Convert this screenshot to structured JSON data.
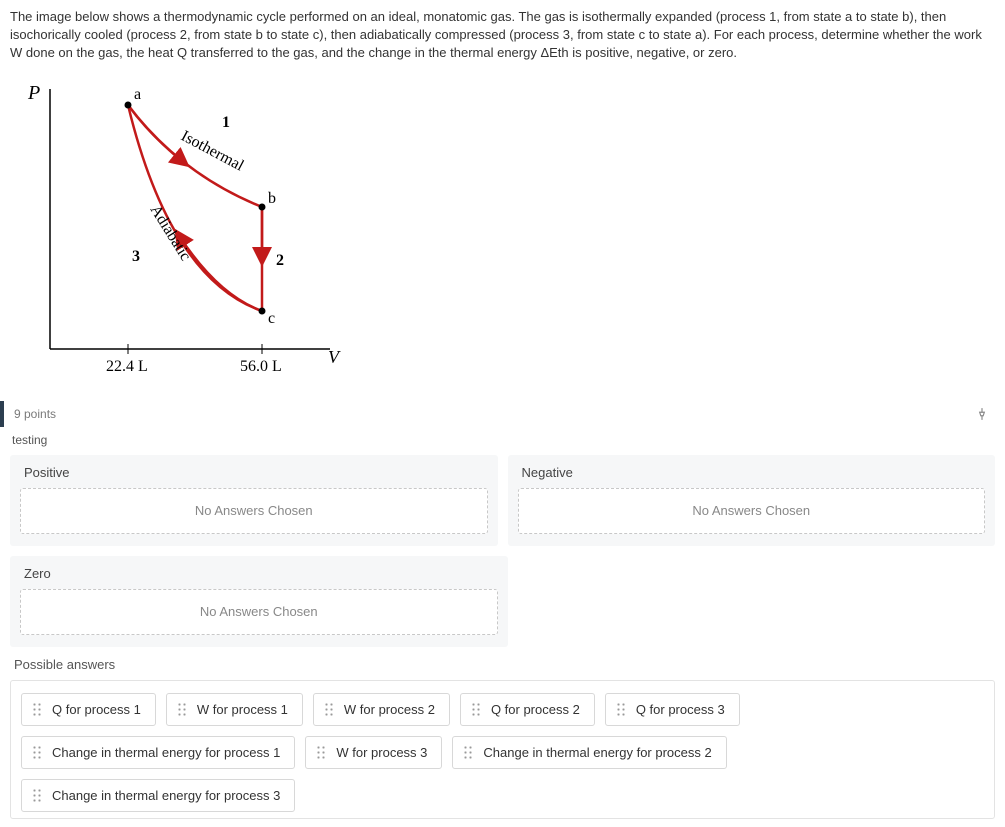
{
  "question": "The image below shows a thermodynamic cycle performed on an ideal, monatomic gas. The gas is isothermally expanded (process 1, from state a to state b), then isochorically cooled (process 2, from state b to state c), then adiabatically compressed (process 3, from state c to state a). For each process, determine whether the work W done on the gas, the heat Q transferred to the gas, and the change in the thermal energy ΔEth is positive, negative, or zero.",
  "diagram": {
    "y_axis_label": "P",
    "x_axis_label": "V",
    "x_ticks": [
      "22.4 L",
      "56.0 L"
    ],
    "points": {
      "a": "a",
      "b": "b",
      "c": "c"
    },
    "curves": {
      "isothermal": {
        "label": "Isothermal",
        "number": "1"
      },
      "isochoric": {
        "number": "2"
      },
      "adiabatic": {
        "label": "Adiabatic",
        "number": "3"
      }
    }
  },
  "points_label": "9 points",
  "subheading": "testing",
  "buckets": {
    "positive": {
      "title": "Positive",
      "placeholder": "No Answers Chosen"
    },
    "negative": {
      "title": "Negative",
      "placeholder": "No Answers Chosen"
    },
    "zero": {
      "title": "Zero",
      "placeholder": "No Answers Chosen"
    }
  },
  "possible_label": "Possible answers",
  "chips": [
    "Q for process 1",
    "W for process 1",
    "W for process 2",
    "Q for process 2",
    "Q for process 3",
    "Change in thermal energy for process 1",
    "W for process 3",
    "Change in thermal energy for process 2",
    "Change in thermal energy for process 3"
  ]
}
